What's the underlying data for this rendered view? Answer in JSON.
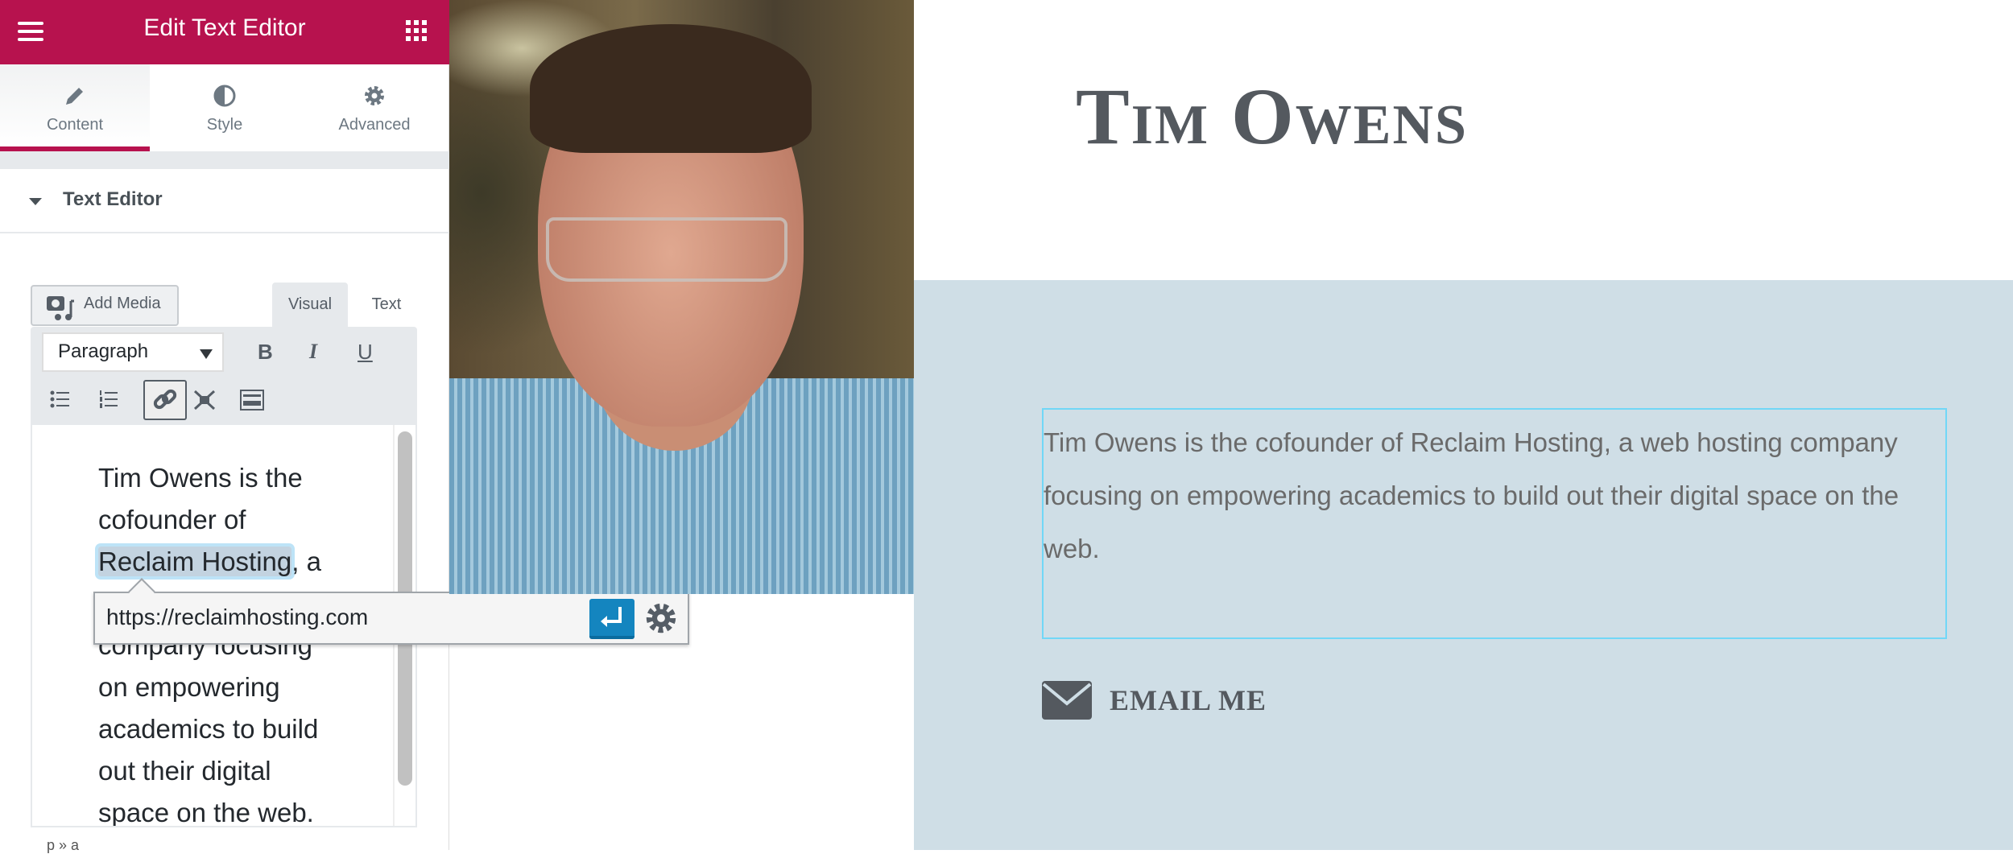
{
  "panel": {
    "title": "Edit Text Editor",
    "menu_icon": "hamburger-icon",
    "apps_icon": "grid-icon",
    "tabs": [
      {
        "label": "Content",
        "icon": "pencil-icon"
      },
      {
        "label": "Style",
        "icon": "contrast-icon"
      },
      {
        "label": "Advanced",
        "icon": "gear-icon"
      }
    ],
    "section_title": "Text Editor",
    "add_media": "Add Media",
    "editor_tabs": {
      "visual": "Visual",
      "text": "Text"
    },
    "format_select": "Paragraph",
    "toolbar": {
      "bold": "B",
      "italic": "I",
      "underline": "U"
    },
    "content": {
      "before": "Tim Owens is the cofounder of ",
      "link": "Reclaim Hosting",
      "after": ", a web hosting company focusing on empowering academics to build out their digital space on the web."
    },
    "link_popup": {
      "url": "https://reclaimhosting.com"
    },
    "path": "p » a",
    "accent": "#b7124e"
  },
  "page": {
    "name": "Tim Owens",
    "bio": "Tim Owens is the cofounder of Reclaim Hosting, a web hosting company focusing on empowering academics to build out their digital space on the web.",
    "email_label": "EMAIL ME",
    "background": "#cfdee6"
  }
}
